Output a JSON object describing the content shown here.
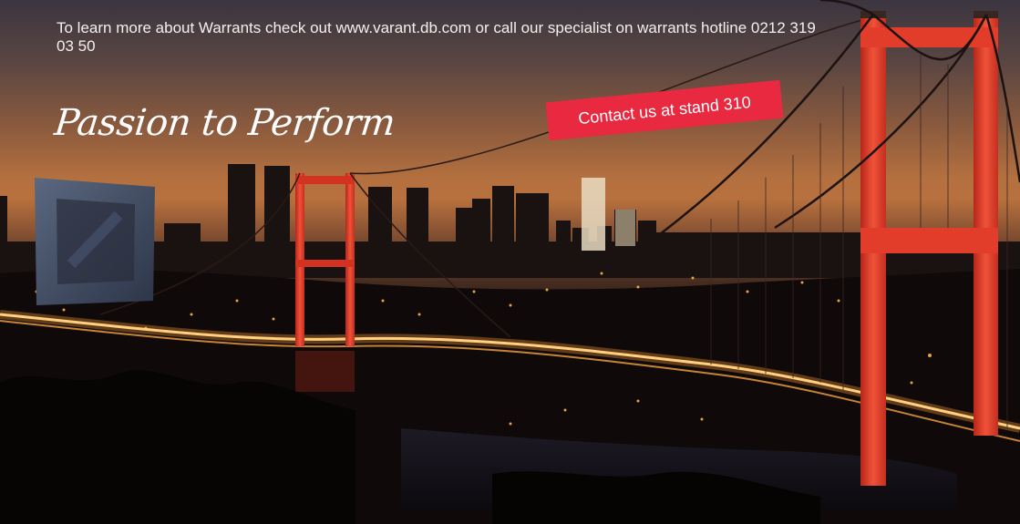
{
  "ad": {
    "info_text": "To learn more about Warrants check out www.varant.db.com or call our specialist on warrants hotline 0212 319 03 50",
    "slogan": "Passion to Perform",
    "contact_label": "Contact us at stand 310"
  },
  "colors": {
    "accent_red": "#e8293f",
    "bridge_red": "#e23c2a",
    "text_white": "#f3f0ee"
  },
  "icons": {
    "logo": "deutsche-bank-logo-icon"
  }
}
